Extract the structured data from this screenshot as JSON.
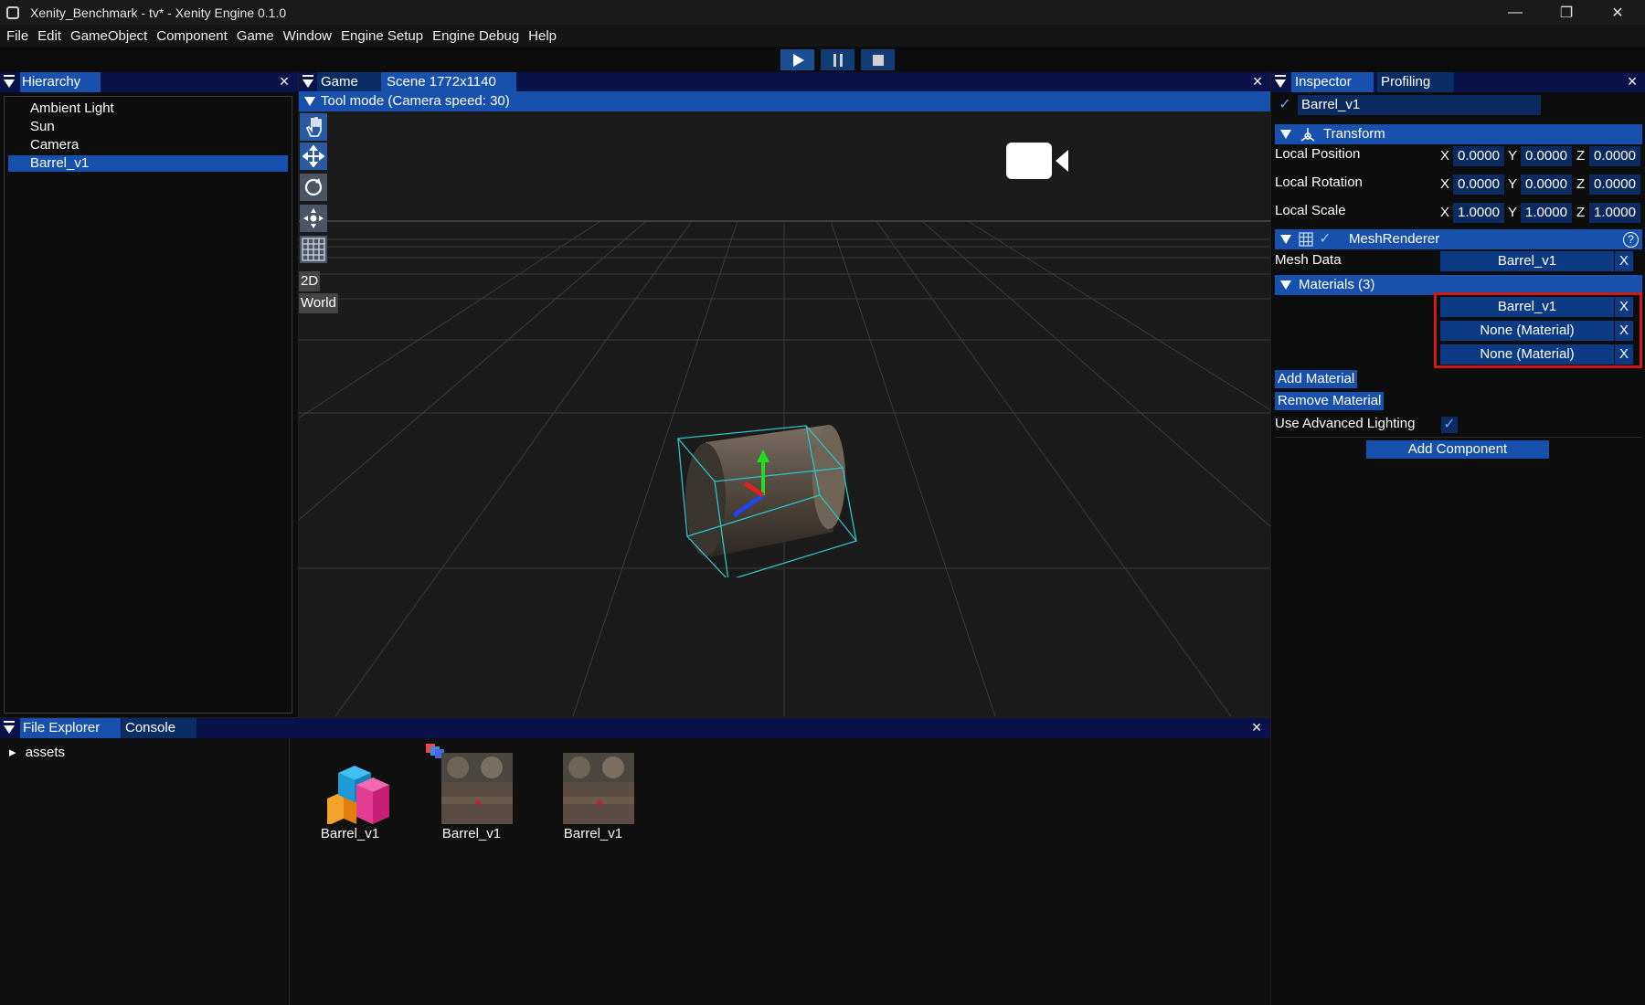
{
  "window": {
    "title": "Xenity_Benchmark - tv* - Xenity Engine 0.1.0",
    "minimize": "—",
    "restore": "❐",
    "close": "✕"
  },
  "menu": [
    "File",
    "Edit",
    "GameObject",
    "Component",
    "Game",
    "Window",
    "Engine Setup",
    "Engine Debug",
    "Help"
  ],
  "hierarchy": {
    "tab": "Hierarchy",
    "items": [
      "Ambient Light",
      "Sun",
      "Camera",
      "Barrel_v1"
    ],
    "selected": "Barrel_v1"
  },
  "viewport": {
    "tab_game": "Game",
    "tab_scene": "Scene 1772x1140",
    "tool_mode": "Tool mode (Camera speed: 30)",
    "label_2d": "2D",
    "label_world": "World"
  },
  "inspector": {
    "tab_inspector": "Inspector",
    "tab_profiling": "Profiling",
    "object_name": "Barrel_v1",
    "transform": {
      "header": "Transform",
      "rows": [
        {
          "label": "Local Position",
          "x": "0.0000",
          "y": "0.0000",
          "z": "0.0000"
        },
        {
          "label": "Local Rotation",
          "x": "0.0000",
          "y": "0.0000",
          "z": "0.0000"
        },
        {
          "label": "Local Scale",
          "x": "1.0000",
          "y": "1.0000",
          "z": "1.0000"
        }
      ],
      "axis_x": "X",
      "axis_y": "Y",
      "axis_z": "Z"
    },
    "mesh_renderer": {
      "header": "MeshRenderer",
      "help": "?",
      "mesh_data_label": "Mesh Data",
      "mesh_data_value": "Barrel_v1",
      "clear": "X",
      "materials_header": "Materials (3)",
      "materials": [
        "Barrel_v1",
        "None (Material)",
        "None (Material)"
      ],
      "add_material": "Add Material",
      "remove_material": "Remove Material",
      "advanced_lighting_label": "Use Advanced Lighting",
      "add_component": "Add Component"
    }
  },
  "files": {
    "tab_files": "File Explorer",
    "tab_console": "Console",
    "tree_root": "assets",
    "tree_arrow": "▸",
    "items": [
      "Barrel_v1",
      "Barrel_v1",
      "Barrel_v1"
    ]
  },
  "colors": {
    "accent": "#1751ad",
    "tab_bar": "#09134a",
    "highlight_border": "#d01818",
    "selection_box": "#2cc3c8"
  }
}
